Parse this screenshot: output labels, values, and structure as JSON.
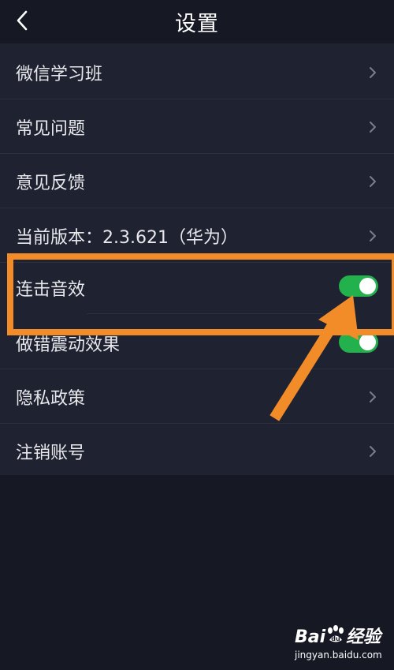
{
  "header": {
    "title": "设置",
    "back_icon": "chevron-left-icon"
  },
  "settings": {
    "items": [
      {
        "label": "微信学习班",
        "type": "link"
      },
      {
        "label": "常见问题",
        "type": "link"
      },
      {
        "label": "意见反馈",
        "type": "link"
      },
      {
        "label": "当前版本：2.3.621（华为）",
        "type": "link"
      },
      {
        "label": "连击音效",
        "type": "toggle",
        "on": true
      },
      {
        "label": "做错震动效果",
        "type": "toggle",
        "on": true
      },
      {
        "label": "隐私政策",
        "type": "link"
      },
      {
        "label": "注销账号",
        "type": "link"
      }
    ]
  },
  "annotation": {
    "color": "#f28c28",
    "highlight_target": "连击音效"
  },
  "watermark": {
    "logo_text": "Baidu经验",
    "logo_prefix": "Bai",
    "logo_suffix": "经验",
    "paw_text": "du",
    "url": "jingyan.baidu.com"
  },
  "colors": {
    "background": "#161823",
    "list_background": "#1f2230",
    "toggle_on": "#22b14c",
    "text": "#e8e8ec"
  }
}
